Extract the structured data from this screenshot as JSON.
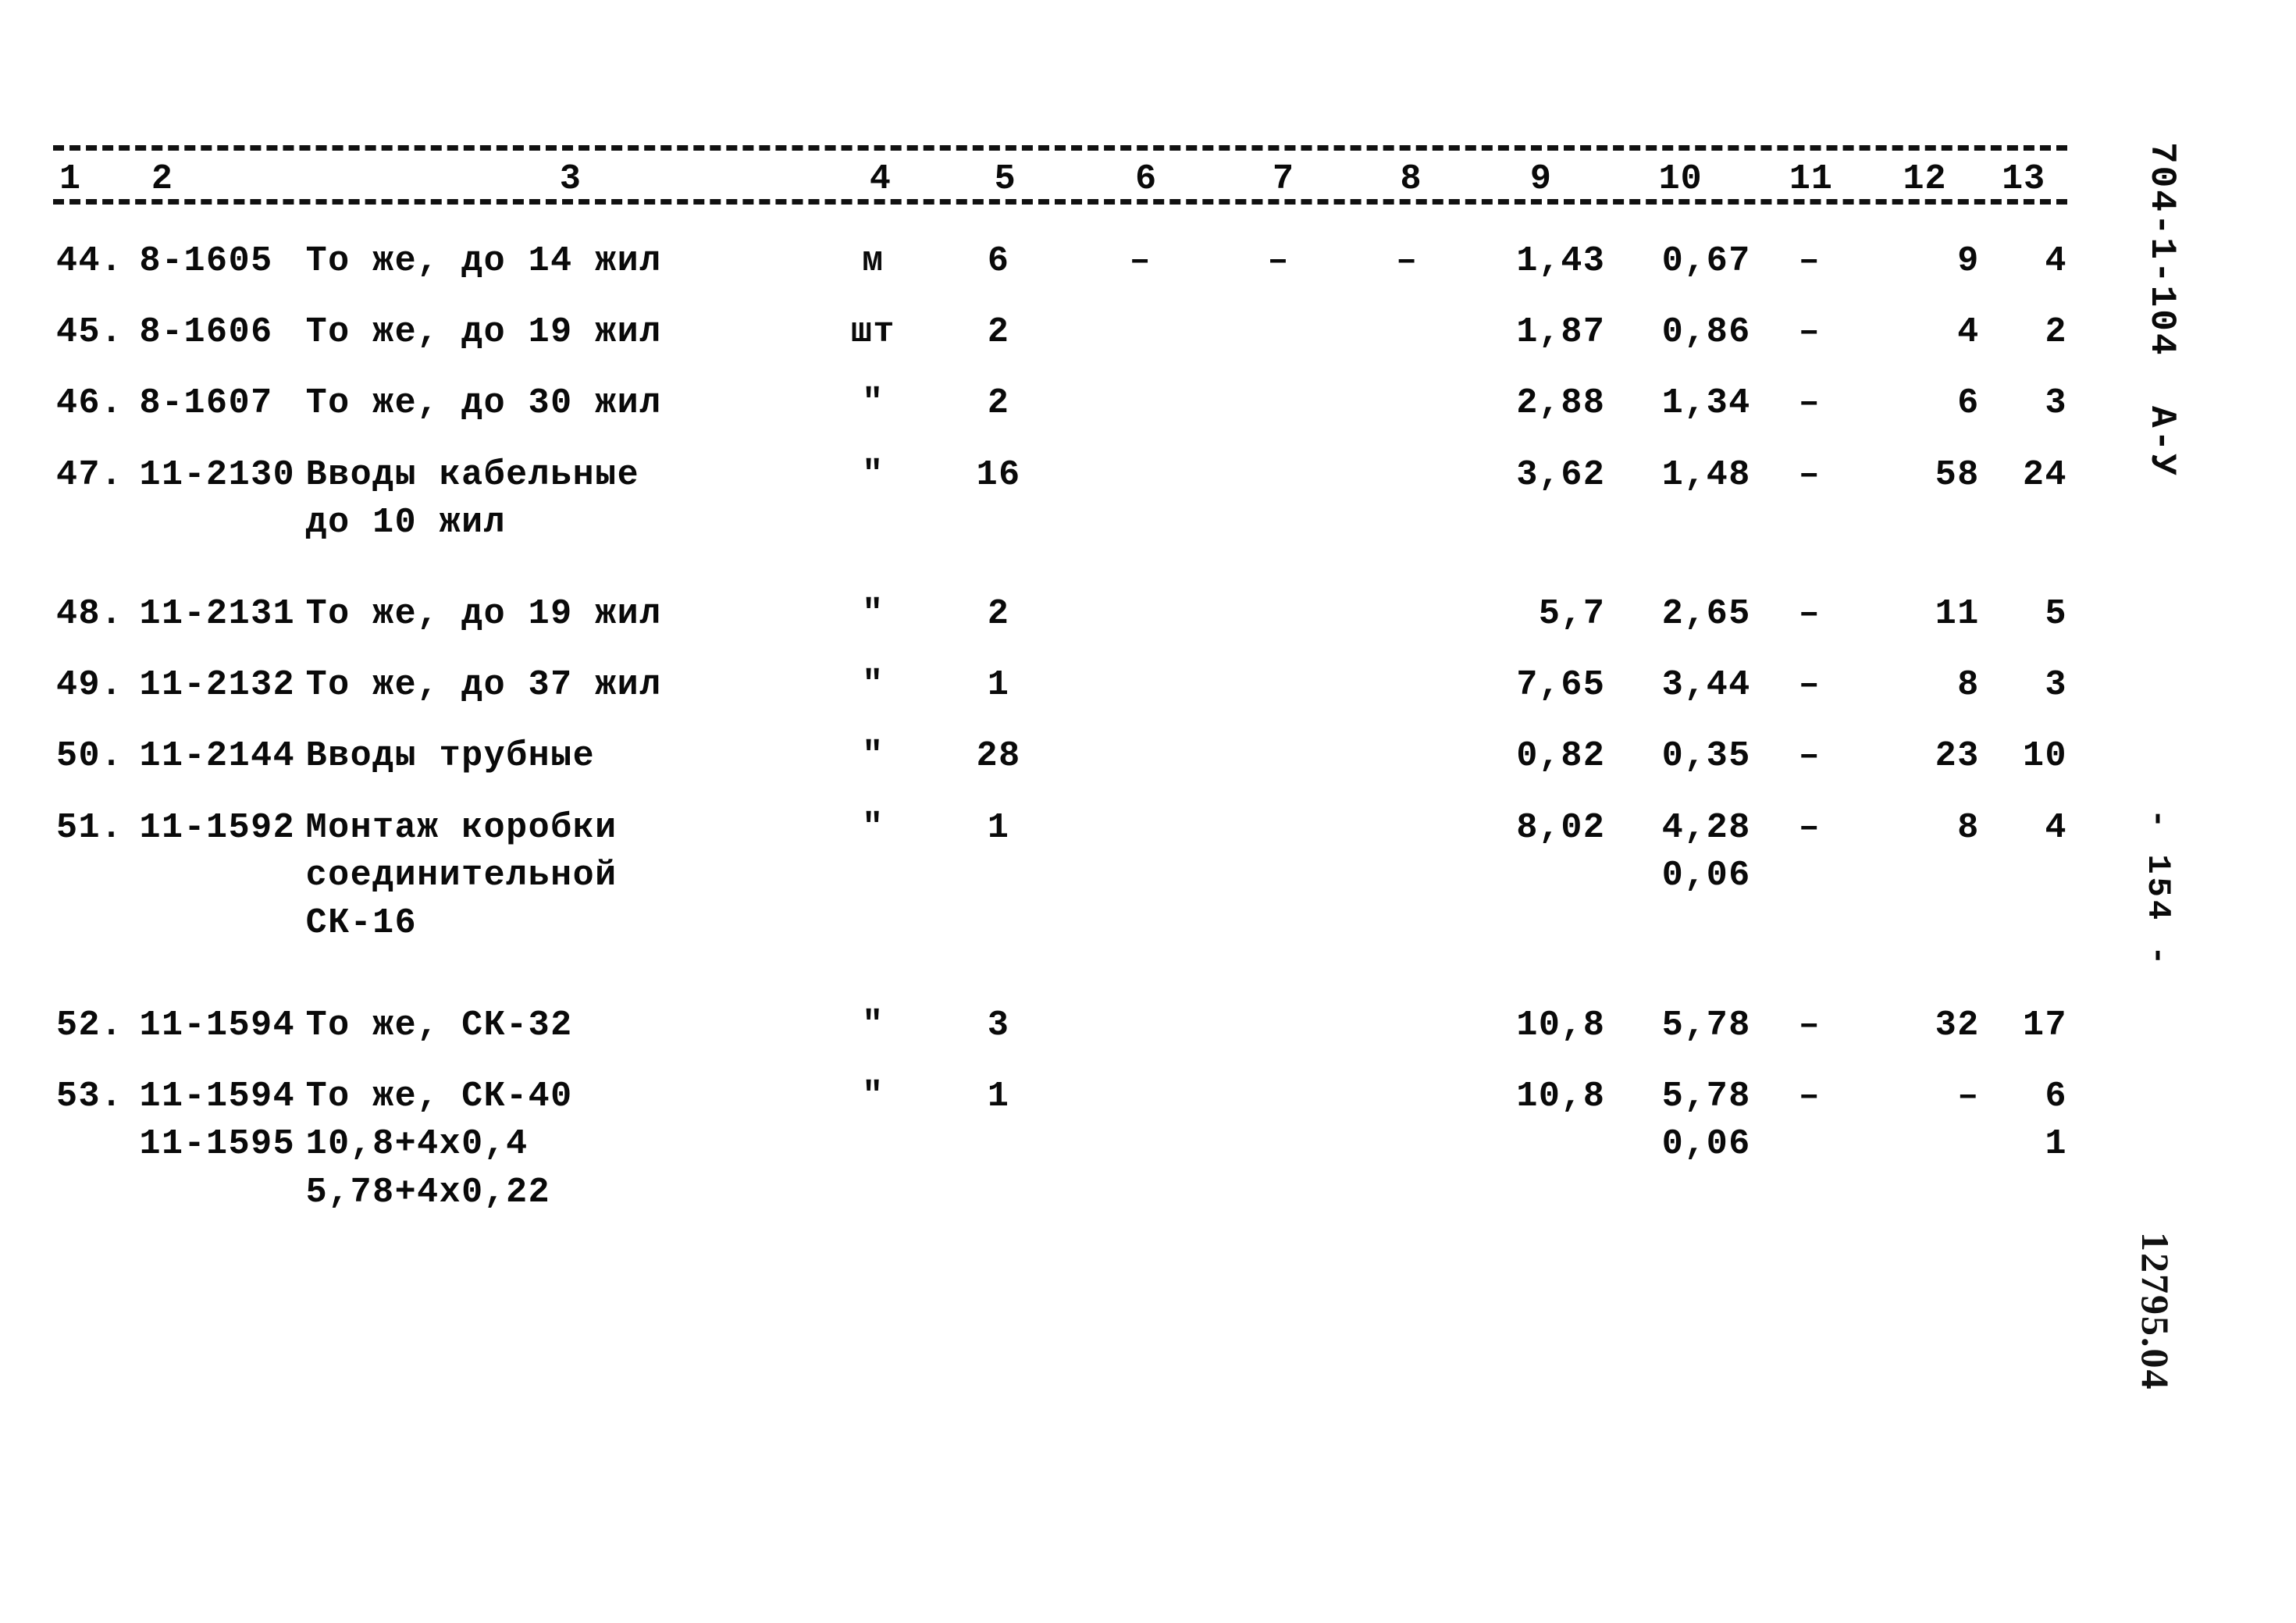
{
  "document": {
    "code": "704-1-104",
    "series": "А-У",
    "page_label": "- 154 -",
    "archive_stamp": "12795.04"
  },
  "table": {
    "column_numbers": [
      "1",
      "2",
      "3",
      "4",
      "5",
      "6",
      "7",
      "8",
      "9",
      "10",
      "11",
      "12",
      "13"
    ],
    "rows": [
      {
        "num": "44.",
        "code": [
          "8-1605"
        ],
        "name": [
          "То же, до 14 жил"
        ],
        "unit": "м",
        "qty": "6",
        "c6": "–",
        "c7": "–",
        "c8": "–",
        "c9": [
          "1,43"
        ],
        "c10": [
          "0,67"
        ],
        "c11": "–",
        "c12": [
          "9"
        ],
        "c13": [
          "4"
        ]
      },
      {
        "num": "45.",
        "code": [
          "8-1606"
        ],
        "name": [
          "То же, до 19 жил"
        ],
        "unit": "шт",
        "qty": "2",
        "c6": "",
        "c7": "",
        "c8": "",
        "c9": [
          "1,87"
        ],
        "c10": [
          "0,86"
        ],
        "c11": "–",
        "c12": [
          "4"
        ],
        "c13": [
          "2"
        ]
      },
      {
        "num": "46.",
        "code": [
          "8-1607"
        ],
        "name": [
          "То же, до 30 жил"
        ],
        "unit": "\"",
        "qty": "2",
        "c6": "",
        "c7": "",
        "c8": "",
        "c9": [
          "2,88"
        ],
        "c10": [
          "1,34"
        ],
        "c11": "–",
        "c12": [
          "6"
        ],
        "c13": [
          "3"
        ]
      },
      {
        "num": "47.",
        "code": [
          "11-2130"
        ],
        "name": [
          "Вводы кабельные",
          "до 10 жил"
        ],
        "unit": "\"",
        "qty": "16",
        "c6": "",
        "c7": "",
        "c8": "",
        "c9": [
          "3,62"
        ],
        "c10": [
          "1,48"
        ],
        "c11": "–",
        "c12": [
          "58"
        ],
        "c13": [
          "24"
        ]
      },
      {
        "num": "48.",
        "code": [
          "11-2131"
        ],
        "name": [
          "То же, до 19 жил"
        ],
        "unit": "\"",
        "qty": "2",
        "c6": "",
        "c7": "",
        "c8": "",
        "c9": [
          "5,7"
        ],
        "c10": [
          "2,65"
        ],
        "c11": "–",
        "c12": [
          "11"
        ],
        "c13": [
          "5"
        ]
      },
      {
        "num": "49.",
        "code": [
          "11-2132"
        ],
        "name": [
          "То же, до 37 жил"
        ],
        "unit": "\"",
        "qty": "1",
        "c6": "",
        "c7": "",
        "c8": "",
        "c9": [
          "7,65"
        ],
        "c10": [
          "3,44"
        ],
        "c11": "–",
        "c12": [
          "8"
        ],
        "c13": [
          "3"
        ]
      },
      {
        "num": "50.",
        "code": [
          "11-2144"
        ],
        "name": [
          "Вводы трубные"
        ],
        "unit": "\"",
        "qty": "28",
        "c6": "",
        "c7": "",
        "c8": "",
        "c9": [
          "0,82"
        ],
        "c10": [
          "0,35"
        ],
        "c11": "–",
        "c12": [
          "23"
        ],
        "c13": [
          "10"
        ]
      },
      {
        "num": "51.",
        "code": [
          "11-1592"
        ],
        "name": [
          "Монтаж коробки",
          "соединительной",
          "СК-16"
        ],
        "unit": "\"",
        "qty": "1",
        "c6": "",
        "c7": "",
        "c8": "",
        "c9": [
          "8,02"
        ],
        "c10": [
          "4,28",
          "0,06"
        ],
        "c11": "–",
        "c12": [
          "8"
        ],
        "c13": [
          "4"
        ]
      },
      {
        "num": "52.",
        "code": [
          "11-1594"
        ],
        "name": [
          "То же, СК-32"
        ],
        "unit": "\"",
        "qty": "3",
        "c6": "",
        "c7": "",
        "c8": "",
        "c9": [
          "10,8"
        ],
        "c10": [
          "5,78"
        ],
        "c11": "–",
        "c12": [
          "32"
        ],
        "c13": [
          "17"
        ]
      },
      {
        "num": "53.",
        "code": [
          "11-1594",
          "11-1595"
        ],
        "name": [
          "То же, СК-40",
          "10,8+4х0,4",
          "5,78+4х0,22"
        ],
        "unit": "\"",
        "qty": "1",
        "c6": "",
        "c7": "",
        "c8": "",
        "c9": [
          "10,8"
        ],
        "c10": [
          "5,78",
          "0,06"
        ],
        "c11": "–",
        "c12": [
          "–"
        ],
        "c13": [
          "6",
          "1"
        ]
      }
    ]
  }
}
